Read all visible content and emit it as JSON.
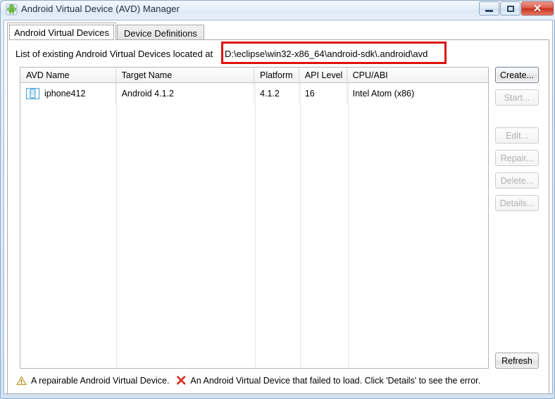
{
  "window": {
    "title": "Android Virtual Device (AVD) Manager",
    "app_icon": "android-robot-icon",
    "controls": {
      "minimize": "minimize-icon",
      "maximize": "maximize-icon",
      "close": "✕"
    }
  },
  "tabs": [
    {
      "label": "Android Virtual Devices",
      "active": true
    },
    {
      "label": "Device Definitions",
      "active": false
    }
  ],
  "main": {
    "list_label": "List of existing Android Virtual Devices located at",
    "avd_path": "D:\\eclipse\\win32-x86_64\\android-sdk\\.android\\avd",
    "annotation_color": "#e01010"
  },
  "table": {
    "headers": [
      "AVD Name",
      "Target Name",
      "Platform",
      "API Level",
      "CPU/ABI"
    ],
    "rows": [
      {
        "icon": "android-device-icon",
        "avd_name": "iphone412",
        "target_name": "Android 4.1.2",
        "platform": "4.1.2",
        "api_level": "16",
        "cpu_abi": "Intel Atom (x86)"
      }
    ]
  },
  "buttons": {
    "create": {
      "label": "Create...",
      "enabled": true
    },
    "start": {
      "label": "Start...",
      "enabled": false
    },
    "edit": {
      "label": "Edit...",
      "enabled": false
    },
    "repair": {
      "label": "Repair...",
      "enabled": false
    },
    "delete": {
      "label": "Delete...",
      "enabled": false
    },
    "details": {
      "label": "Details...",
      "enabled": false
    },
    "refresh": {
      "label": "Refresh",
      "enabled": true
    }
  },
  "status": {
    "warning_icon": "warning-triangle-icon",
    "warning_text": "A repairable Android Virtual Device.",
    "error_icon": "red-x-icon",
    "error_text": "An Android Virtual Device that failed to load. Click 'Details' to see the error."
  }
}
